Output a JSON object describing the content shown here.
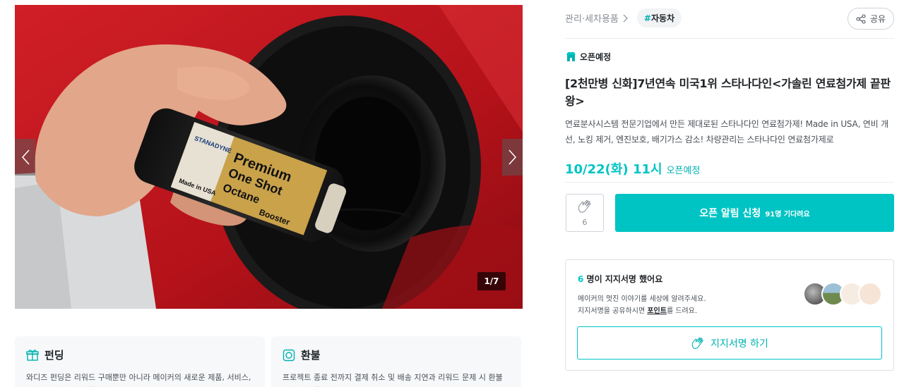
{
  "gallery": {
    "counter": "1/7",
    "label_text": {
      "brand": "STANADYNE",
      "line1": "Premium",
      "line2": "One Shot",
      "line3": "Octane",
      "line4": "Booster",
      "line5": "Made in USA"
    }
  },
  "cards": {
    "funding": {
      "title": "펀딩",
      "body": "와디즈 펀딩은 리워드 구매뿐만 아니라 메이커의 새로운 제품, 서비스, 콘텐츠 제작을 지원합니다."
    },
    "refund": {
      "title": "환불",
      "body": "프로젝트 종료 전까지 결제 취소 및 배송 지연과 리워드 문제 시 환불 신청 가능합니다."
    }
  },
  "header": {
    "category": "관리·세차용품",
    "tag": "자동차",
    "tag_hash": "#",
    "share_label": "공유"
  },
  "project": {
    "status": "오픈예정",
    "title": "[2천만병 신화]7년연속 미국1위 스타나다인<가솔린 연료첨가제 끝판왕>",
    "description": "연료분사시스템 전문기업에서 만든 제대로된 스타나다인 연료첨가제! Made in USA, 연비 개선, 노킹 제거, 엔진보호, 배기가스 감소! 차량관리는 스타나다인 연료첨가제로",
    "open_date": "10/22(화) 11시",
    "open_label": "오픈예정"
  },
  "actions": {
    "like_count": "6",
    "notify_main": "오픈 알림 신청",
    "notify_sub": "91명 기다려요"
  },
  "support": {
    "count": "6",
    "title_rest": "명이 지지서명 했어요",
    "line1": "메이커의 멋진 이야기를 세상에 알려주세요.",
    "line2_pre": "지지서명을 공유하시면 ",
    "line2_point": "포인트",
    "line2_post": "를 드려요.",
    "button": "지지서명 하기"
  },
  "colors": {
    "accent": "#00c4c4",
    "accent_text": "#00b2b2"
  }
}
